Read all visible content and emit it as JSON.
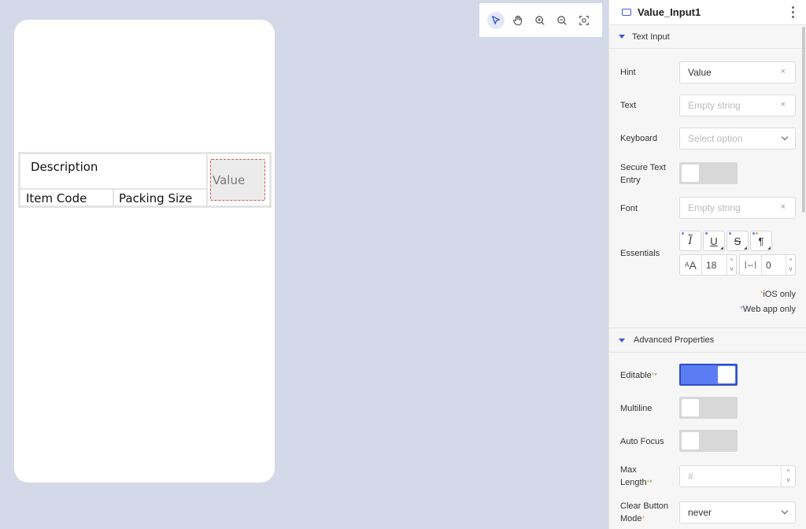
{
  "canvas": {
    "table": {
      "description": "Description",
      "item_code": "Item Code",
      "packing_size": "Packing Size",
      "value_hint": "Value"
    }
  },
  "toolbar": {
    "tools": [
      "select-pointer",
      "hand-pan",
      "zoom-in",
      "zoom-out",
      "fit-screen"
    ]
  },
  "panel": {
    "component_name": "Value_Input1",
    "section_text_input": "Text Input",
    "hint": {
      "label": "Hint",
      "value": "Value"
    },
    "text": {
      "label": "Text",
      "placeholder": "Empty string"
    },
    "keyboard": {
      "label": "Keyboard",
      "placeholder": "Select option"
    },
    "secure": {
      "label_line1": "Secure Text",
      "label_line2": "Entry",
      "on": false
    },
    "font": {
      "label": "Font",
      "placeholder": "Empty string"
    },
    "essentials": {
      "label": "Essentials",
      "font_size": "18",
      "letter_spacing": "0"
    },
    "ios_only": "iOS only",
    "web_only": "Web app only",
    "section_advanced": "Advanced Properties",
    "editable": {
      "label": "Editable",
      "on": true
    },
    "multiline": {
      "label": "Multiline",
      "on": false
    },
    "autofocus": {
      "label": "Auto Focus",
      "on": false
    },
    "max_length": {
      "label_line1": "Max",
      "label_line2": "Length",
      "placeholder": "#"
    },
    "clear_button": {
      "label_line1": "Clear Button",
      "label_line2": "Mode",
      "value": "never"
    }
  },
  "colors": {
    "accent": "#3f5bd6",
    "toggle_on": "#5b7cf3",
    "canvas_bg": "#d3d9e8"
  }
}
